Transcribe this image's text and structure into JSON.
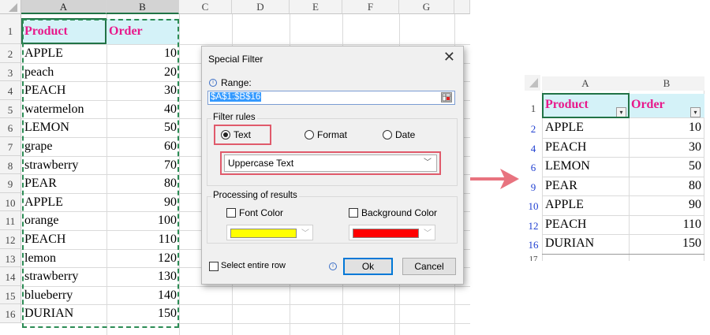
{
  "left_sheet": {
    "columns": [
      "A",
      "B",
      "C",
      "D",
      "E",
      "F",
      "G"
    ],
    "headers": {
      "product": "Product",
      "order": "Order"
    },
    "rows": [
      {
        "n": "2",
        "product": "APPLE",
        "order": "10"
      },
      {
        "n": "3",
        "product": "peach",
        "order": "20"
      },
      {
        "n": "4",
        "product": "PEACH",
        "order": "30"
      },
      {
        "n": "5",
        "product": "watermelon",
        "order": "40"
      },
      {
        "n": "6",
        "product": "LEMON",
        "order": "50"
      },
      {
        "n": "7",
        "product": "grape",
        "order": "60"
      },
      {
        "n": "8",
        "product": "strawberry",
        "order": "70"
      },
      {
        "n": "9",
        "product": "PEAR",
        "order": "80"
      },
      {
        "n": "10",
        "product": "APPLE",
        "order": "90"
      },
      {
        "n": "11",
        "product": "orange",
        "order": "100"
      },
      {
        "n": "12",
        "product": "PEACH",
        "order": "110"
      },
      {
        "n": "13",
        "product": "lemon",
        "order": "120"
      },
      {
        "n": "14",
        "product": "strawberry",
        "order": "130"
      },
      {
        "n": "15",
        "product": "blueberry",
        "order": "140"
      },
      {
        "n": "16",
        "product": "DURIAN",
        "order": "150"
      }
    ],
    "header_row_number": "1"
  },
  "dialog": {
    "title": "Special Filter",
    "range_label": "Range:",
    "range_value": "$A$1:$B$16",
    "filter_rules_label": "Filter rules",
    "radio_text": "Text",
    "radio_format": "Format",
    "radio_date": "Date",
    "combo_value": "Uppercase Text",
    "processing_label": "Processing of results",
    "font_color_label": "Font Color",
    "bg_color_label": "Background Color",
    "font_color_swatch": "#ffff00",
    "bg_color_swatch": "#ff0000",
    "select_row_label": "Select entire row",
    "ok_label": "Ok",
    "cancel_label": "Cancel"
  },
  "arrow_color": "#e8737f",
  "right_sheet": {
    "columns": [
      "A",
      "B"
    ],
    "headers": {
      "product": "Product",
      "order": "Order"
    },
    "header_row_number": "1",
    "rows": [
      {
        "n": "2",
        "product": "APPLE",
        "order": "10"
      },
      {
        "n": "4",
        "product": "PEACH",
        "order": "30"
      },
      {
        "n": "6",
        "product": "LEMON",
        "order": "50"
      },
      {
        "n": "9",
        "product": "PEAR",
        "order": "80"
      },
      {
        "n": "10",
        "product": "APPLE",
        "order": "90"
      },
      {
        "n": "12",
        "product": "PEACH",
        "order": "110"
      },
      {
        "n": "16",
        "product": "DURIAN",
        "order": "150"
      }
    ],
    "last_row_number": "17"
  }
}
